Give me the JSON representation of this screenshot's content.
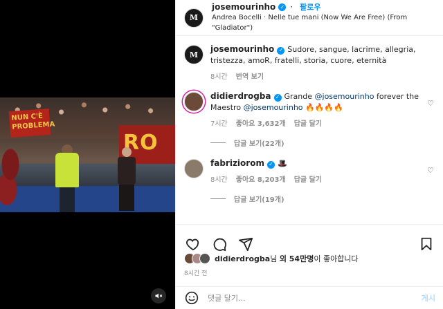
{
  "header": {
    "username": "josemourinho",
    "avatar_text": "M",
    "follow_label": "팔로우",
    "music": "Andrea Bocelli · Nelle tue mani (Now We Are Free) (From \"Gladiator\")"
  },
  "media": {
    "banner1": "NUN C'È PROBLEMA",
    "banner2": "RO"
  },
  "caption": {
    "username": "josemourinho",
    "text": "Sudore, sangue, lacrime, allegria, tristezza, amoR, fratelli, storia, cuore, eternità",
    "time": "8시간",
    "translate": "번역 보기"
  },
  "comments": [
    {
      "username": "didierdrogba",
      "text_pre": "Grande ",
      "mention1": "@josemourinho",
      "text_mid": " forever the Maestro ",
      "mention2": "@josemourinho",
      "emojis": "🔥🔥🔥🔥",
      "time": "7시간",
      "likes": "좋아요 3,632개",
      "reply": "답글 달기",
      "view_replies": "답글 보기(22개)"
    },
    {
      "username": "fabriziorom",
      "emoji": "🎩",
      "time": "8시간",
      "likes": "좋아요 8,203개",
      "reply": "답글 달기",
      "view_replies": "답글 보기(19개)"
    }
  ],
  "likes_line": {
    "user": "didierdrogba",
    "suffix1": "님 ",
    "others": "외 54만명",
    "suffix2": "이 좋아합니다"
  },
  "post_time": "8시간 전",
  "composer": {
    "placeholder": "댓글 달기...",
    "post_label": "게시"
  },
  "colors": {
    "accent": "#0095f6",
    "link": "#00376b",
    "muted": "#8e8e8e"
  }
}
